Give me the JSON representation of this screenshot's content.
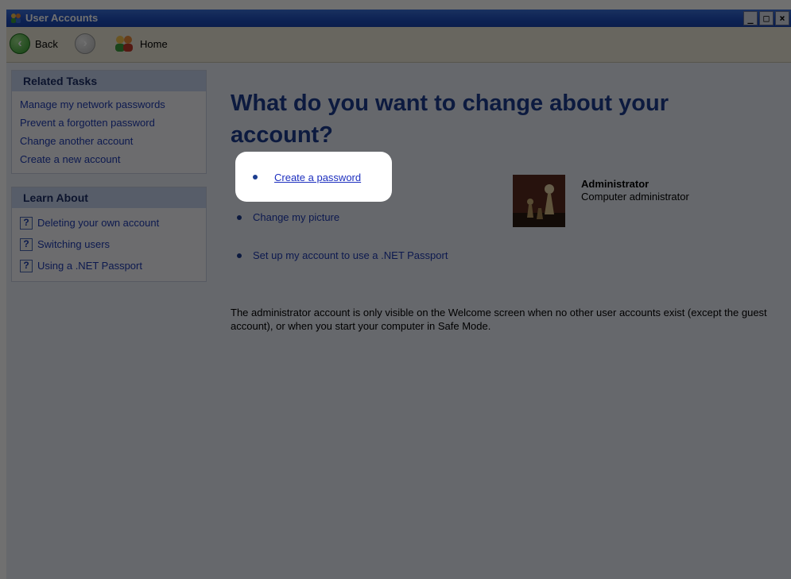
{
  "window": {
    "title": "User Accounts"
  },
  "toolbar": {
    "back_label": "Back",
    "home_label": "Home"
  },
  "sidebar": {
    "related_tasks": {
      "heading": "Related Tasks",
      "items": [
        "Manage my network passwords",
        "Prevent a forgotten password",
        "Change another account",
        "Create a new account"
      ]
    },
    "learn_about": {
      "heading": "Learn About",
      "items": [
        "Deleting your own account",
        "Switching users",
        "Using a .NET Passport"
      ]
    }
  },
  "main": {
    "heading": "What do you want to change about your account?",
    "actions": [
      "Create a password",
      "Change my picture",
      "Set up my account to use a .NET Passport"
    ],
    "account": {
      "name": "Administrator",
      "type": "Computer administrator"
    },
    "note": "The administrator account is only visible on the Welcome screen when no other user accounts exist (except the guest account), or when you start your computer in Safe Mode."
  },
  "icons": {
    "title_icon": "users-icon",
    "back": "back-arrow-icon",
    "forward": "forward-arrow-icon",
    "home": "home-users-icon",
    "help": "help-icon",
    "avatar": "chess-pieces-picture"
  },
  "colors": {
    "heading": "#1c3d8f",
    "link": "#1f3bb3",
    "titlebar": "#1f4fbf",
    "panel_header": "#c7d3ef"
  }
}
